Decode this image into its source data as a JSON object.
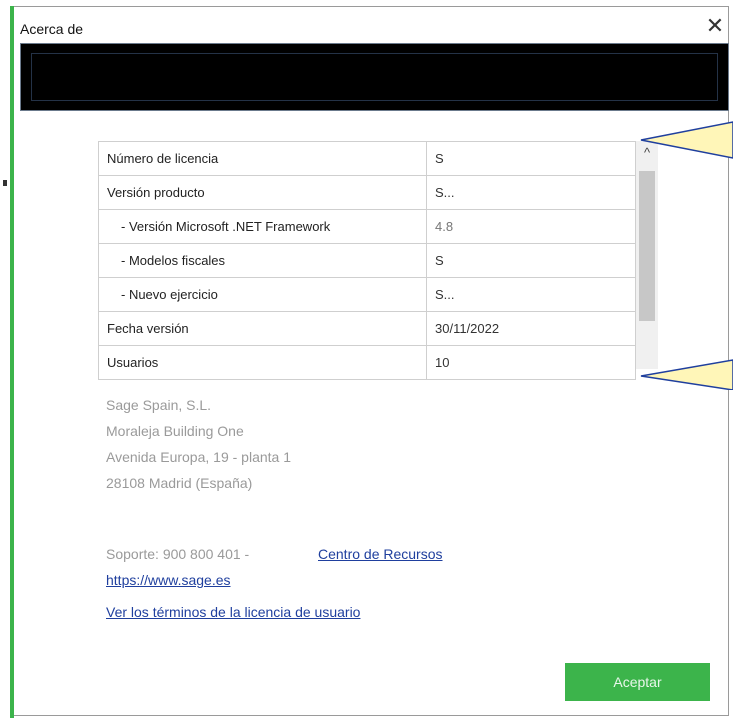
{
  "window": {
    "title": "Acerca de",
    "close_icon": "close-icon"
  },
  "license_table": {
    "rows": [
      {
        "label": "Número de licencia",
        "value": "S"
      },
      {
        "label": "Versión producto",
        "value": "S..."
      },
      {
        "label": "- Versión Microsoft .NET Framework",
        "value": "4.8"
      },
      {
        "label": "- Modelos fiscales",
        "value": "S"
      },
      {
        "label": "- Nuevo ejercicio",
        "value": "S..."
      },
      {
        "label": "Fecha versión",
        "value": "30/11/2022"
      },
      {
        "label": "Usuarios",
        "value": "10"
      }
    ]
  },
  "company": {
    "name": "Sage Spain, S.L.",
    "building": "Moraleja Building One",
    "street": "Avenida Europa, 19 - planta 1",
    "city": "28108 Madrid (España)"
  },
  "support": {
    "phone_text": "Soporte: 900 800 401 -",
    "resources_link": "Centro de Recursos",
    "website_link": "https://www.sage.es",
    "license_terms_link": "Ver los términos de la licencia de usuario"
  },
  "buttons": {
    "accept": "Aceptar"
  },
  "colors": {
    "accent": "#3cb44b",
    "link": "#1f3f9e",
    "banner": "#000000",
    "callout_fill": "#fff6b8"
  }
}
